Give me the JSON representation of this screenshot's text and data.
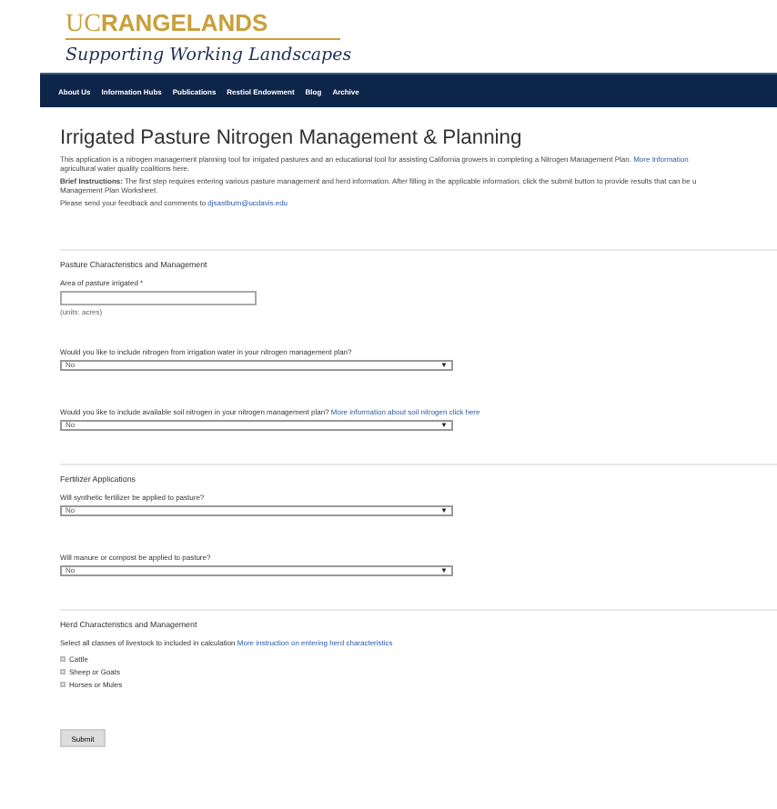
{
  "logo": {
    "brand_light": "UC",
    "brand_bold": "RANGELANDS",
    "tagline": "Supporting Working Landscapes"
  },
  "nav": [
    {
      "label": "About Us"
    },
    {
      "label": "Information Hubs"
    },
    {
      "label": "Publications"
    },
    {
      "label": "Restiol Endowment"
    },
    {
      "label": "Blog"
    },
    {
      "label": "Archive"
    }
  ],
  "title": "Irrigated Pasture Nitrogen Management & Planning",
  "intro": [
    {
      "text": "This application is a nitrogen management planning tool for irrigated pastures and an educational tool for assisting California growers in completing a Nitrogen Management Plan.",
      "link": "More Information",
      "text_after": "agricultural water quality coalitions here."
    },
    {
      "text": "**Brief Instructions:** The first step requires entering various pasture management and herd information. After filling in the applicable information, click the submit button to provide results that can be u",
      "text_after": "Management Plan Worksheet."
    },
    {
      "text": "Please send your feedback and comments to",
      "link": "djsastburn@ucdavis.edu"
    }
  ],
  "sections": [
    {
      "heading": "Pasture Characteristics and Management",
      "fields": [
        {
          "kind": "text",
          "label": "Area of pasture irrigated *",
          "hint": "(units: acres)"
        },
        {
          "kind": "select",
          "label": "Would you like to include nitrogen from irrigation water in your nitrogen management plan?",
          "value": "No",
          "arrow": "▼"
        },
        {
          "kind": "select",
          "label": "Would you like to include available soil nitrogen in your nitrogen management plan?",
          "link": "More information about soil nitrogen click here",
          "value": "No",
          "arrow": "▼"
        }
      ]
    },
    {
      "heading": "Fertilizer Applications",
      "fields": [
        {
          "kind": "select",
          "label": "Will synthetic fertilizer be applied to pasture?",
          "value": "No",
          "arrow": "▼"
        },
        {
          "kind": "select",
          "label": "Will manure or compost be applied to pasture?",
          "value": "No",
          "arrow": "▼"
        }
      ]
    },
    {
      "heading": "Herd Characteristics and Management",
      "fields": [
        {
          "kind": "checklist",
          "label": "Select all classes of livestock to included in calculation",
          "link": "More instruction on entering herd characteristics",
          "options": [
            {
              "label": "Cattle",
              "checked": false
            },
            {
              "label": "Sheep or Goats",
              "checked": false
            },
            {
              "label": "Horses or Mules",
              "checked": false
            }
          ]
        }
      ]
    }
  ],
  "submit": "Submit"
}
